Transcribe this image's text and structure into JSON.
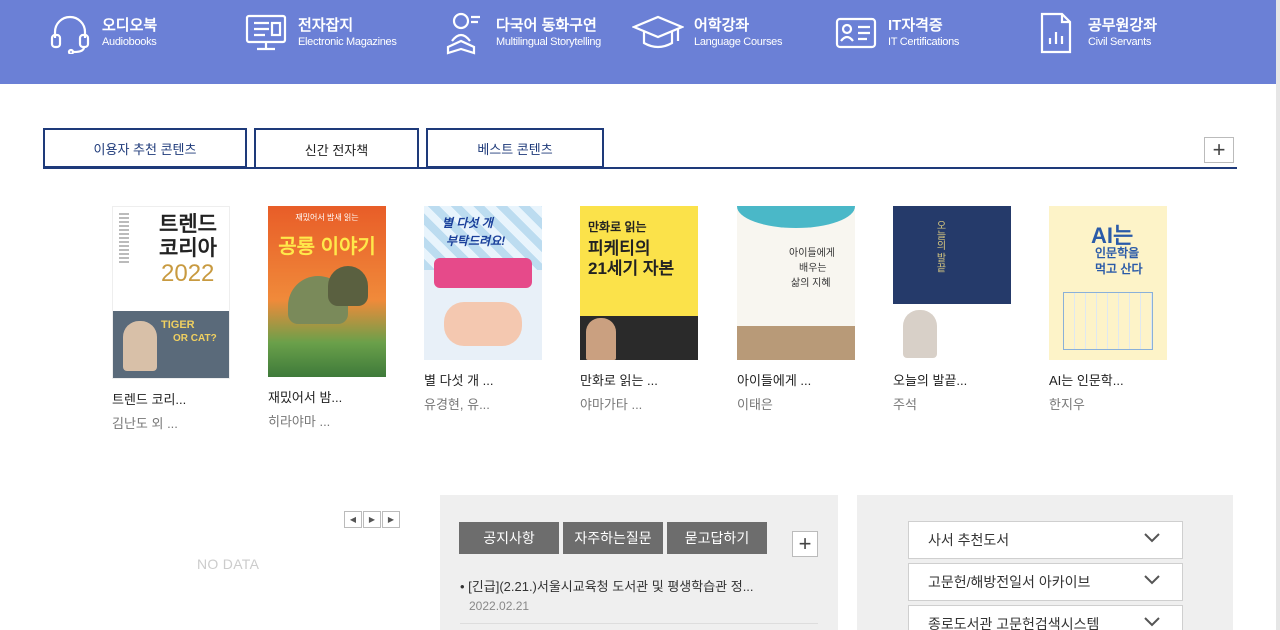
{
  "nav": [
    {
      "ko": "오디오북",
      "en": "Audiobooks",
      "icon": "headphones-icon"
    },
    {
      "ko": "전자잡지",
      "en": "Electronic Magazines",
      "icon": "monitor-icon"
    },
    {
      "ko": "다국어 동화구연",
      "en": "Multilingual Storytelling",
      "icon": "reading-child-icon"
    },
    {
      "ko": "어학강좌",
      "en": "Language Courses",
      "icon": "graduation-cap-icon"
    },
    {
      "ko": "IT자격증",
      "en": "IT Certifications",
      "icon": "id-card-icon"
    },
    {
      "ko": "공무원강좌",
      "en": "Civil Servants",
      "icon": "document-chart-icon"
    }
  ],
  "tabs": [
    {
      "label": "이용자 추천 콘텐츠",
      "active": false
    },
    {
      "label": "신간 전자책",
      "active": true
    },
    {
      "label": "베스트 콘텐츠",
      "active": false
    }
  ],
  "more_symbol": "+",
  "books": [
    {
      "title": "트렌드 코리...",
      "author": "김난도 외 ...",
      "cover_text": [
        "트렌드",
        "코리아",
        "2022",
        "TIGER",
        "OR CAT?"
      ]
    },
    {
      "title": "재밌어서 밤...",
      "author": "히라야마 ...",
      "cover_text": [
        "재밌어서 밤새 읽는",
        "공룡 이야기"
      ]
    },
    {
      "title": "별 다섯 개 ...",
      "author": "유경현, 유...",
      "cover_text": [
        "별 다섯 개",
        "부탁드려요!"
      ]
    },
    {
      "title": "만화로 읽는 ...",
      "author": "야마가타 ...",
      "cover_text": [
        "만화로 읽는",
        "피케티의",
        "21세기 자본"
      ]
    },
    {
      "title": "아이들에게 ...",
      "author": "이태은",
      "cover_text": [
        "아이들에게",
        "배우는",
        "삶의 지혜"
      ]
    },
    {
      "title": "오늘의 발끝...",
      "author": "주석",
      "cover_text": [
        "오늘의 발끝"
      ]
    },
    {
      "title": "AI는 인문학...",
      "author": "한지우",
      "cover_text": [
        "AI는",
        "인문학을",
        "먹고 산다"
      ]
    }
  ],
  "left_panel": {
    "empty_text": "NO DATA",
    "pager": [
      "◀",
      "▶",
      "▶"
    ]
  },
  "notice": {
    "tabs": [
      "공지사항",
      "자주하는질문",
      "묻고답하기"
    ],
    "items": [
      {
        "title": "[긴급](2.21.)서울시교육청 도서관 및 평생학습관 정...",
        "date": "2022.02.21"
      }
    ]
  },
  "links": [
    "사서 추천도서",
    "고문헌/해방전일서 아카이브",
    "종로도서관 고문헌검색시스템"
  ],
  "colors": {
    "nav_bg": "#6b80d6",
    "tab_border": "#1e3a7a",
    "notice_tab": "#6d6d6d",
    "panel_bg": "#efefef"
  }
}
